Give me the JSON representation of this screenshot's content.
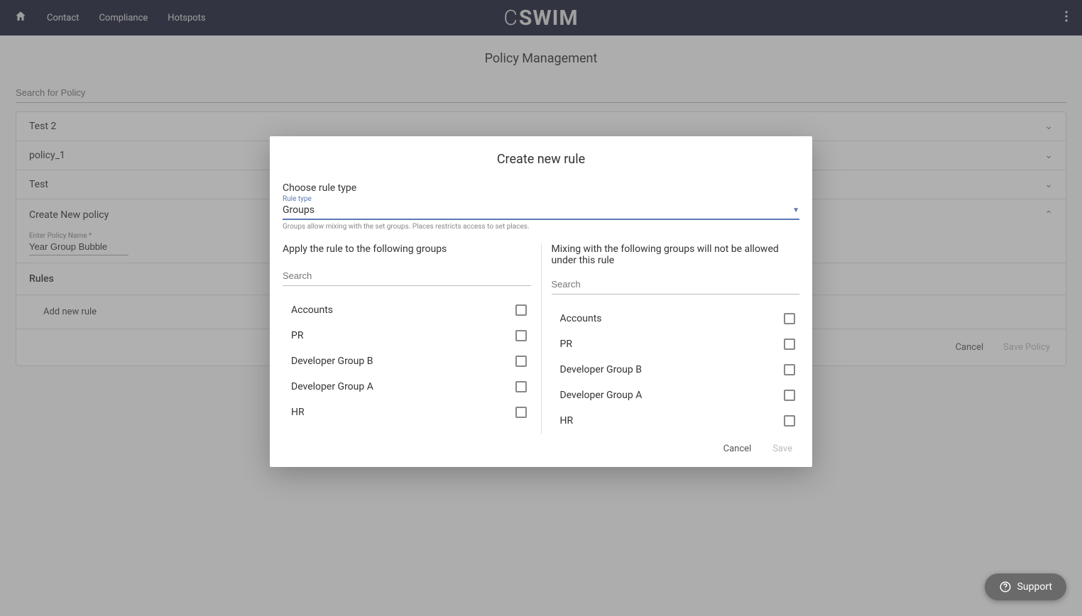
{
  "header": {
    "nav": {
      "contact": "Contact",
      "compliance": "Compliance",
      "hotspots": "Hotspots"
    },
    "logo_prefix": "C",
    "logo_main": "SWIM"
  },
  "page": {
    "title": "Policy Management",
    "search_placeholder": "Search for Policy",
    "policies": [
      {
        "name": "Test 2"
      },
      {
        "name": "policy_1"
      },
      {
        "name": "Test"
      }
    ],
    "create": {
      "heading": "Create New policy",
      "name_label": "Enter Policy Name *",
      "name_value": "Year Group Bubble",
      "rules_heading": "Rules",
      "add_rule": "Add new rule",
      "cancel": "Cancel",
      "save": "Save Policy"
    }
  },
  "modal": {
    "title": "Create new rule",
    "choose_label": "Choose rule type",
    "rule_type_label": "Rule type",
    "rule_type_value": "Groups",
    "rule_type_hint": "Groups allow mixing with the set groups. Places restricts access to set places.",
    "left_title": "Apply the rule to the following groups",
    "right_title": "Mixing with the following groups will not be allowed under this rule",
    "search_placeholder": "Search",
    "groups": [
      "Accounts",
      "PR",
      "Developer Group B",
      "Developer Group A",
      "HR"
    ],
    "cancel": "Cancel",
    "save": "Save"
  },
  "support": {
    "label": "Support"
  }
}
